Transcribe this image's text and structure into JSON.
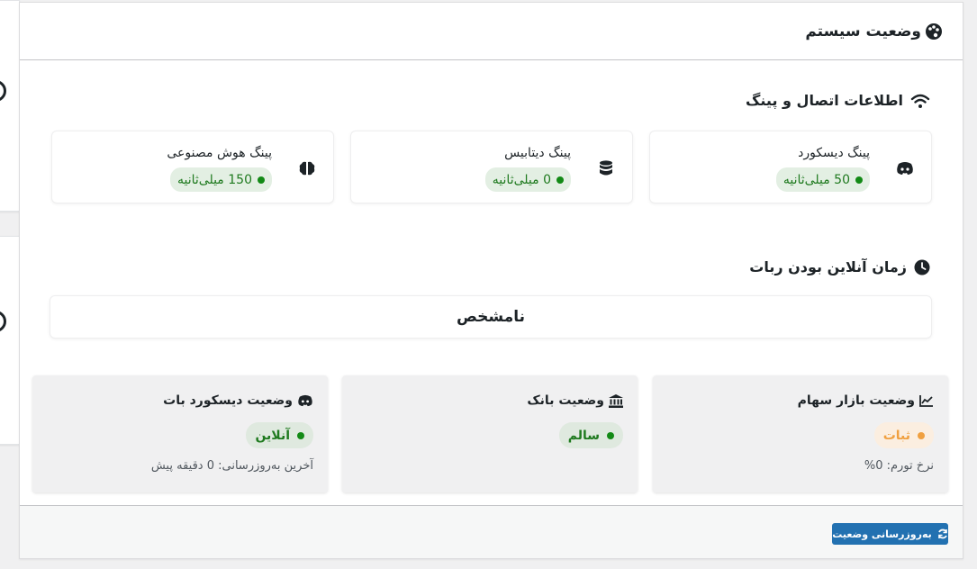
{
  "panel": {
    "title": "وضعیت سیستم",
    "title_icon": "palette-icon"
  },
  "ping_section": {
    "title": "اطلاعات اتصال و پینگ",
    "icon": "wifi-icon",
    "cards": [
      {
        "label": "پینگ دیسکورد",
        "value": "50 میلی‌ثانیه",
        "icon": "discord-icon"
      },
      {
        "label": "پینگ دیتابیس",
        "value": "0 میلی‌ثانیه",
        "icon": "database-icon"
      },
      {
        "label": "پینگ هوش مصنوعی",
        "value": "150 میلی‌ثانیه",
        "icon": "brain-icon"
      }
    ]
  },
  "uptime_section": {
    "title": "زمان آنلاین بودن ربات",
    "icon": "clock-icon",
    "value": "نامشخص"
  },
  "status_cards": [
    {
      "title": "وضعیت بازار سهام",
      "icon": "chart-line-icon",
      "status": "ثبات",
      "status_color": "#f0a040",
      "sub": "نرخ تورم: 0%"
    },
    {
      "title": "وضعیت بانک",
      "icon": "bank-icon",
      "status": "سالم",
      "status_color": "#138a16",
      "sub": ""
    },
    {
      "title": "وضعیت دیسکورد بات",
      "icon": "discord-icon",
      "status": "آنلاین",
      "status_color": "#138a16",
      "sub": "آخرین به‌روزرسانی: 0 دقیقه پیش"
    }
  ],
  "footer": {
    "refresh_label": "به‌روزرسانی وضعیت",
    "refresh_icon": "refresh-icon"
  },
  "colors": {
    "accent": "#2271b1",
    "ok": "#138a16",
    "warn": "#f0a040"
  }
}
